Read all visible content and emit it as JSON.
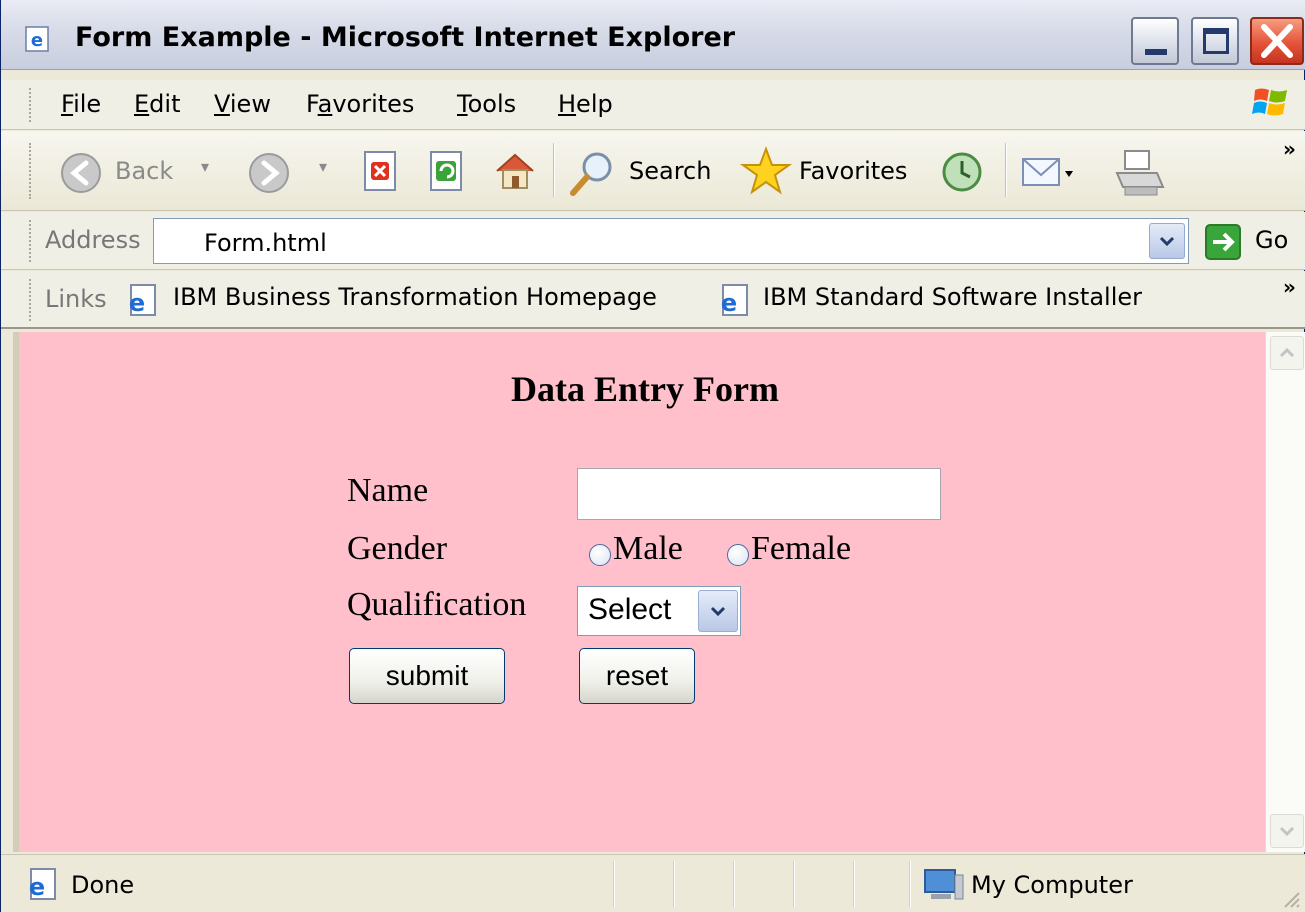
{
  "window": {
    "title": "Form Example - Microsoft Internet Explorer"
  },
  "menu": {
    "items": [
      {
        "label": "File",
        "key": "F",
        "rest": "ile"
      },
      {
        "label": "Edit",
        "key": "E",
        "rest": "dit"
      },
      {
        "label": "View",
        "key": "V",
        "rest": "iew"
      },
      {
        "label": "Favorites",
        "pre": "F",
        "key": "a",
        "rest": "vorites"
      },
      {
        "label": "Tools",
        "key": "T",
        "rest": "ools"
      },
      {
        "label": "Help",
        "key": "H",
        "rest": "elp"
      }
    ]
  },
  "toolbar": {
    "back_label": "Back",
    "search_label": "Search",
    "favorites_label": "Favorites",
    "overflow": "»"
  },
  "address": {
    "label": "Address",
    "value": "Form.html",
    "go_label": "Go"
  },
  "links": {
    "label": "Links",
    "items": [
      "IBM Business Transformation Homepage",
      "IBM Standard Software Installer"
    ],
    "overflow": "»"
  },
  "page": {
    "background": "#ffc0cb",
    "title": "Data Entry Form",
    "name_label": "Name",
    "name_value": "",
    "gender_label": "Gender",
    "gender_options": [
      "Male",
      "Female"
    ],
    "qualification_label": "Qualification",
    "qualification_selected": "Select",
    "submit_label": "submit",
    "reset_label": "reset"
  },
  "status": {
    "text": "Done",
    "zone": "My Computer"
  },
  "icons": {
    "title": "ie-page-icon",
    "back": "back-arrow-icon",
    "forward": "forward-arrow-icon",
    "stop": "stop-icon",
    "refresh": "refresh-icon",
    "home": "home-icon",
    "search": "search-magnifier-icon",
    "favorites": "favorites-star-icon",
    "history": "history-icon",
    "mail": "mail-icon",
    "print": "printer-icon",
    "go": "go-arrow-icon",
    "windows_logo": "windows-logo-icon",
    "status_page": "ie-page-icon",
    "zone": "my-computer-icon"
  }
}
